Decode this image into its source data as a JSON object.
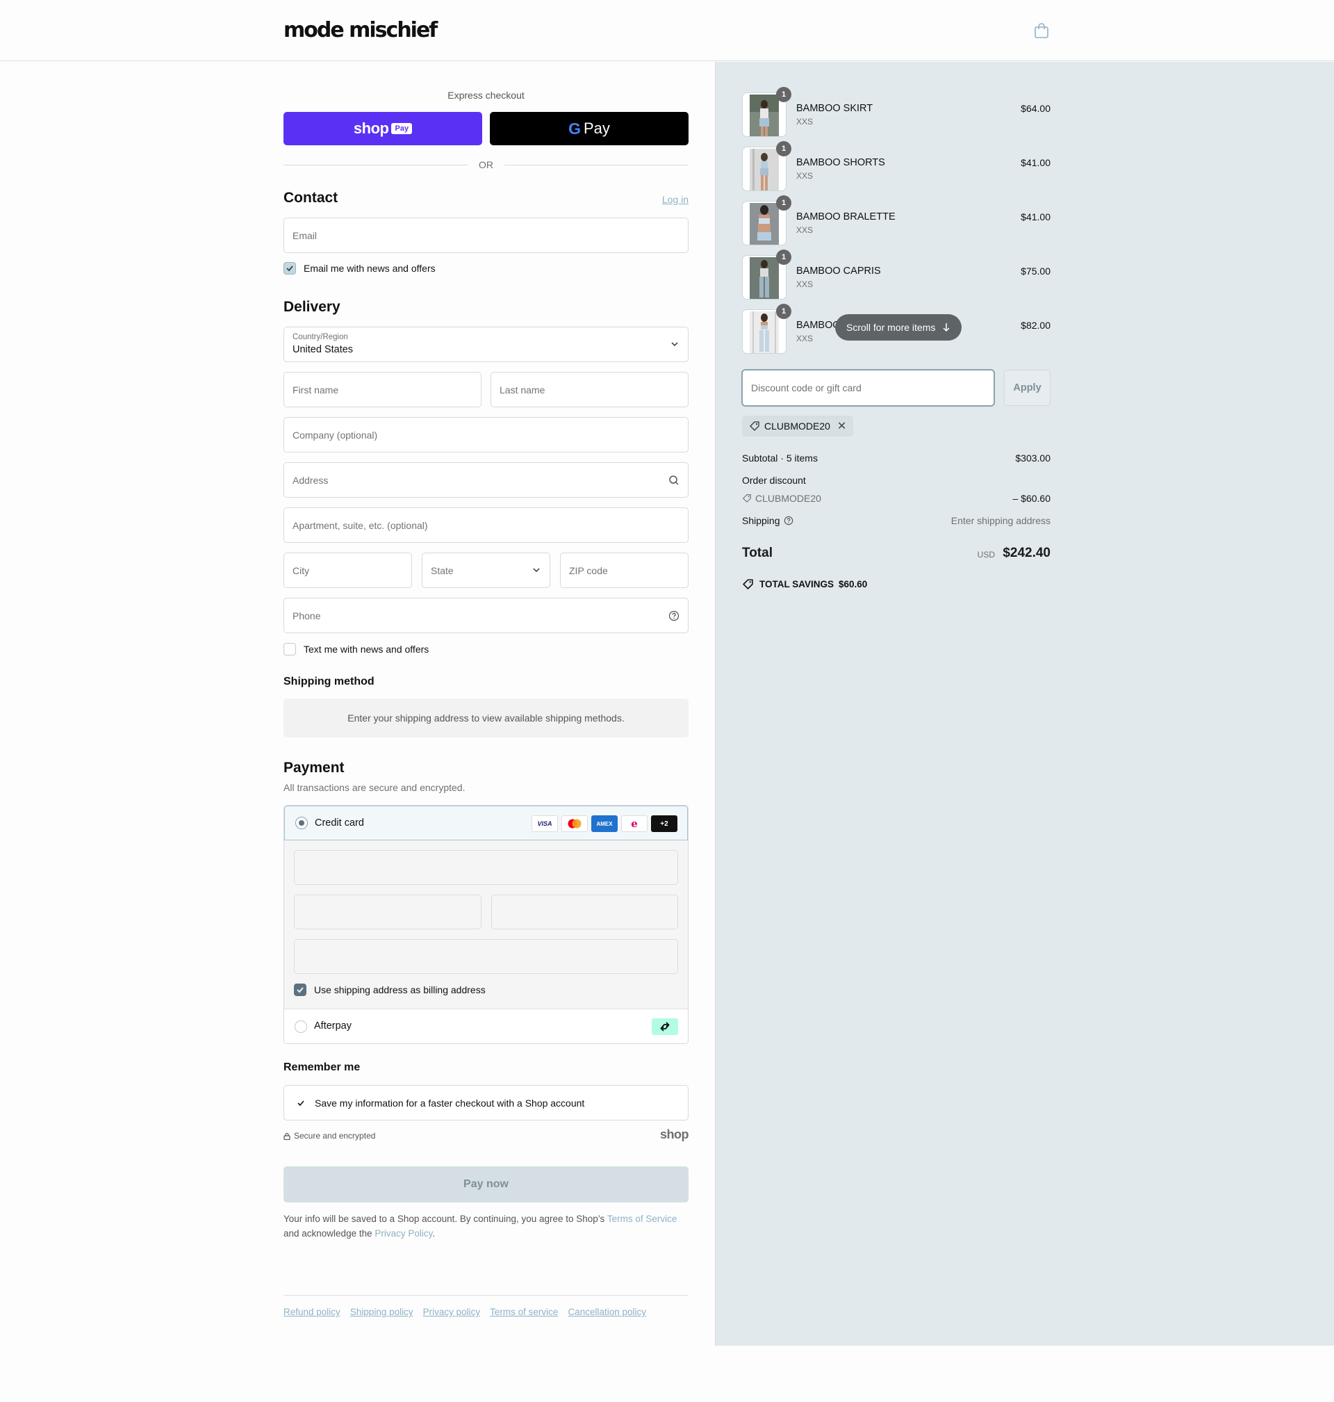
{
  "header": {
    "logo": "mode mischief",
    "cart_icon": "shopping-bag-icon"
  },
  "express": {
    "title": "Express checkout",
    "shop_pay_label": "shop",
    "shop_pay_badge": "Pay",
    "gpay_g": "G",
    "gpay_label": "Pay",
    "or": "OR"
  },
  "contact": {
    "heading": "Contact",
    "login": "Log in",
    "email_placeholder": "Email",
    "newsletter": "Email me with news and offers",
    "newsletter_checked": true
  },
  "delivery": {
    "heading": "Delivery",
    "country_label": "Country/Region",
    "country_value": "United States",
    "first_name": "First name",
    "last_name": "Last name",
    "company": "Company (optional)",
    "address": "Address",
    "apartment": "Apartment, suite, etc. (optional)",
    "city": "City",
    "state": "State",
    "zip": "ZIP code",
    "phone": "Phone",
    "sms": "Text me with news and offers",
    "sms_checked": false
  },
  "shipping_method": {
    "heading": "Shipping method",
    "note": "Enter your shipping address to view available shipping methods."
  },
  "payment": {
    "heading": "Payment",
    "subtitle": "All transactions are secure and encrypted.",
    "credit_card": "Credit card",
    "cards": [
      "VISA",
      "MC",
      "AMEX",
      "e",
      "+2"
    ],
    "billing_same": "Use shipping address as billing address",
    "afterpay": "Afterpay"
  },
  "remember": {
    "heading": "Remember me",
    "save_info": "Save my information for a faster checkout with a Shop account",
    "secure": "Secure and encrypted",
    "shop_mark": "shop"
  },
  "pay_now": "Pay now",
  "legal": {
    "text1": "Your info will be saved to a Shop account. By continuing, you agree to Shop’s ",
    "tos": "Terms of Service",
    "text2": "and acknowledge the ",
    "privacy": "Privacy Policy",
    "text3": "."
  },
  "footer_links": [
    "Refund policy",
    "Shipping policy",
    "Privacy policy",
    "Terms of service",
    "Cancellation policy"
  ],
  "order": {
    "items": [
      {
        "name": "BAMBOO SKIRT",
        "variant": "XXS",
        "price": "$64.00",
        "qty": "1"
      },
      {
        "name": "BAMBOO SHORTS",
        "variant": "XXS",
        "price": "$41.00",
        "qty": "1"
      },
      {
        "name": "BAMBOO BRALETTE",
        "variant": "XXS",
        "price": "$41.00",
        "qty": "1"
      },
      {
        "name": "BAMBOO CAPRIS",
        "variant": "XXS",
        "price": "$75.00",
        "qty": "1"
      },
      {
        "name": "BAMBOO",
        "variant": "XXS",
        "price": "$82.00",
        "qty": "1"
      }
    ],
    "scroll_hint": "Scroll for more items",
    "discount_placeholder": "Discount code or gift card",
    "apply": "Apply",
    "applied_code": "CLUBMODE20",
    "subtotal_label": "Subtotal · 5 items",
    "subtotal": "$303.00",
    "order_discount_label": "Order discount",
    "discount_code": "CLUBMODE20",
    "discount_amount": "– $60.60",
    "shipping_label": "Shipping",
    "shipping_value": "Enter shipping address",
    "total_label": "Total",
    "currency": "USD",
    "total": "$242.40",
    "savings_label": "TOTAL SAVINGS",
    "savings": "$60.60"
  },
  "colors": {
    "accent": "#8fb1c4",
    "shop_pay": "#5a31f4",
    "panel": "#e1e9ec"
  }
}
